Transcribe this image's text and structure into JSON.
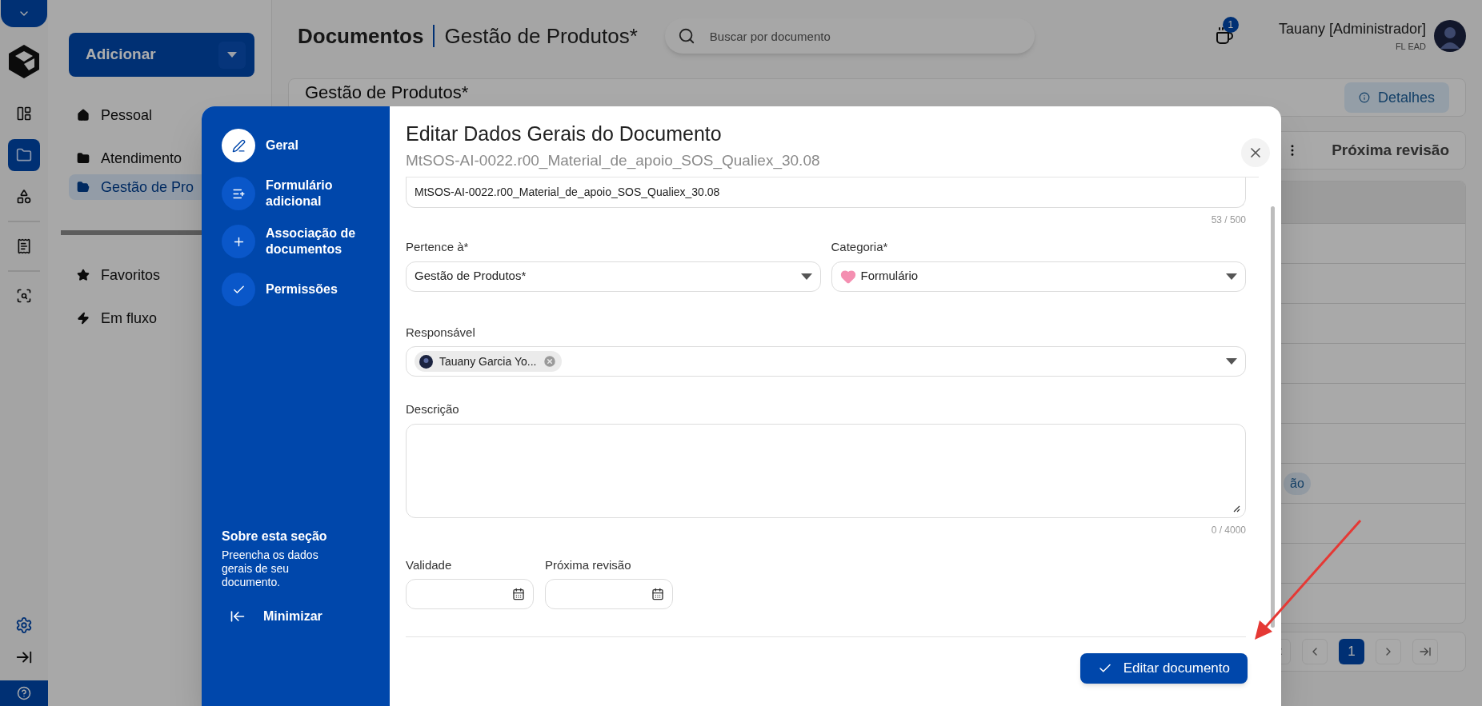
{
  "rail": {
    "items": [
      {
        "kind": "dashboard",
        "selected": false
      },
      {
        "kind": "folder",
        "selected": true
      },
      {
        "kind": "shapes",
        "selected": false
      },
      {
        "kind": "report",
        "selected": false
      },
      {
        "kind": "scan",
        "selected": false
      }
    ],
    "bottom_items": [
      {
        "kind": "settings"
      },
      {
        "kind": "expand"
      },
      {
        "kind": "help"
      }
    ]
  },
  "sidebar": {
    "add_button": "Adicionar",
    "groups": [
      {
        "items": [
          {
            "kind": "home",
            "label": "Pessoal",
            "selected": false
          },
          {
            "kind": "folder",
            "label": "Atendimento",
            "selected": false
          },
          {
            "kind": "folder_open",
            "label": "Gestão de Pro",
            "selected": true
          }
        ]
      },
      {
        "items": [
          {
            "kind": "star",
            "label": "Favoritos",
            "selected": false
          },
          {
            "kind": "flash",
            "label": "Em fluxo",
            "selected": false
          }
        ]
      }
    ]
  },
  "header": {
    "title": "Documentos",
    "subtitle": "Gestão de Produtos*",
    "search": {
      "placeholder": "Buscar por documento"
    },
    "notifications": "1",
    "user": "Tauany [Administrador]",
    "org": "FL EAD"
  },
  "page": {
    "card_title": "Gestão de Produtos*",
    "details_button": "Detalhes",
    "column": "Próxima revisão",
    "rows": [
      {},
      {},
      {},
      {},
      {},
      {},
      {
        "tag": "ão"
      },
      {},
      {},
      {}
    ],
    "pagination": [
      {
        "kind": "first"
      },
      {
        "kind": "prev"
      },
      {
        "kind": "page",
        "label": "1",
        "selected": true
      },
      {
        "kind": "next"
      },
      {
        "kind": "last"
      }
    ]
  },
  "modal": {
    "steps": [
      {
        "kind": "general",
        "label": "Geral",
        "selected": true
      },
      {
        "kind": "form",
        "label": "Formulário adicional",
        "selected": false
      },
      {
        "kind": "link",
        "label": "Associação de documentos",
        "selected": false
      },
      {
        "kind": "permissions",
        "label": "Permissões",
        "selected": false
      }
    ],
    "about_title": "Sobre esta seção",
    "about_text": "Preencha os dados gerais de seu documento.",
    "minimize": "Minimizar",
    "title": "Editar Dados Gerais do Documento",
    "subtitle": "MtSOS-AI-0022.r00_Material_de_apoio_SOS_Qualiex_30.08",
    "name_field": {
      "value": "MtSOS-AI-0022.r00_Material_de_apoio_SOS_Qualiex_30.08",
      "counter": "53 / 500"
    },
    "belongs_to": {
      "label": "Pertence à*",
      "value": "Gestão de Produtos*"
    },
    "category": {
      "label": "Categoria*",
      "value": "Formulário"
    },
    "responsible": {
      "label": "Responsável",
      "chips": [
        "Tauany Garcia Yo..."
      ]
    },
    "description": {
      "label": "Descrição",
      "counter": "0 / 4000"
    },
    "validity": {
      "label": "Validade"
    },
    "next_review": {
      "label": "Próxima revisão"
    },
    "submit": "Editar documento"
  }
}
